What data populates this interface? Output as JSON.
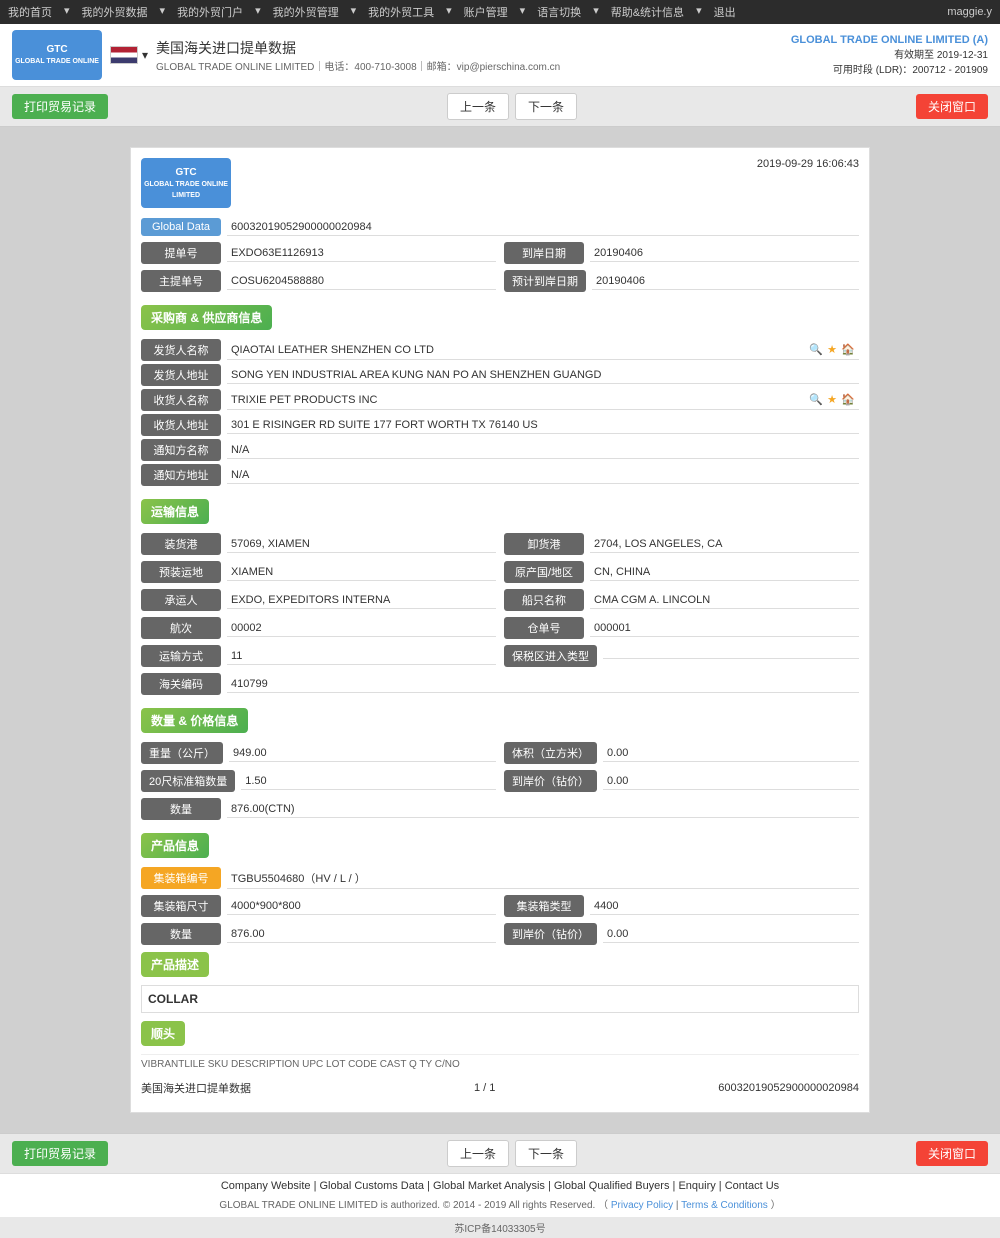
{
  "topnav": {
    "items": [
      "我的首页",
      "我的外贸数据",
      "我的外贸门户",
      "我的外贸管理",
      "我的外贸工具",
      "账户管理",
      "语言切换",
      "帮助&统计信息",
      "退出"
    ],
    "user": "maggie.y"
  },
  "header": {
    "title": "美国海关进口提单数据",
    "subtitle": "GLOBAL TRADE ONLINE LIMITED｜电话：400-710-3008｜邮箱：vip@pierschina.com.cn",
    "company": "GLOBAL TRADE ONLINE LIMITED (A)",
    "expiry_label": "有效期至",
    "expiry_date": "2019-12-31",
    "ldr_label": "可用时段 (LDR)：200712 - 201909"
  },
  "toolbar": {
    "print_label": "打印贸易记录",
    "prev_label": "上一条",
    "next_label": "下一条",
    "close_label": "关闭窗口"
  },
  "document": {
    "datetime": "2019-09-29 16:06:43",
    "global_data_label": "Global Data",
    "global_data_value": "60032019052900000020984",
    "bill_label": "提单号",
    "bill_value": "EXDO63E1126913",
    "arrival_date_label": "到岸日期",
    "arrival_date_value": "20190406",
    "master_bill_label": "主提单号",
    "master_bill_value": "COSU6204588880",
    "estimated_date_label": "预计到岸日期",
    "estimated_date_value": "20190406"
  },
  "shipper": {
    "section_label": "采购商 & 供应商信息",
    "shipper_name_label": "发货人名称",
    "shipper_name_value": "QIAOTAI LEATHER SHENZHEN CO LTD",
    "shipper_addr_label": "发货人地址",
    "shipper_addr_value": "SONG YEN INDUSTRIAL AREA KUNG NAN PO AN SHENZHEN GUANGD",
    "consignee_name_label": "收货人名称",
    "consignee_name_value": "TRIXIE PET PRODUCTS INC",
    "consignee_addr_label": "收货人地址",
    "consignee_addr_value": "301 E RISINGER RD SUITE 177 FORT WORTH TX 76140 US",
    "notify_name_label": "通知方名称",
    "notify_name_value": "N/A",
    "notify_addr_label": "通知方地址",
    "notify_addr_value": "N/A"
  },
  "transport": {
    "section_label": "运输信息",
    "loading_port_label": "装货港",
    "loading_port_value": "57069, XIAMEN",
    "discharge_port_label": "卸货港",
    "discharge_port_value": "2704, LOS ANGELES, CA",
    "pre_load_label": "预装运地",
    "pre_load_value": "XIAMEN",
    "origin_label": "原产国/地区",
    "origin_value": "CN, CHINA",
    "carrier_label": "承运人",
    "carrier_value": "EXDO, EXPEDITORS INTERNA",
    "vessel_label": "船只名称",
    "vessel_value": "CMA CGM A. LINCOLN",
    "voyage_label": "航次",
    "voyage_value": "00002",
    "warehouse_label": "仓单号",
    "warehouse_value": "000001",
    "transport_mode_label": "运输方式",
    "transport_mode_value": "11",
    "bonded_label": "保税区进入类型",
    "bonded_value": "",
    "customs_label": "海关编码",
    "customs_value": "410799"
  },
  "quantity": {
    "section_label": "数量 & 价格信息",
    "weight_label": "重量（公斤）",
    "weight_value": "949.00",
    "volume_label": "体积（立方米）",
    "volume_value": "0.00",
    "twenty_ft_label": "20尺标准箱数量",
    "twenty_ft_value": "1.50",
    "arrival_price_label": "到岸价（钻价）",
    "arrival_price_value": "0.00",
    "quantity_label": "数量",
    "quantity_value": "876.00(CTN)"
  },
  "product": {
    "section_label": "产品信息",
    "container_no_label": "集装箱编号",
    "container_no_value": "TGBU5504680（HV / L / ）",
    "container_size_label": "集装箱尺寸",
    "container_size_value": "4000*900*800",
    "container_type_label": "集装箱类型",
    "container_type_value": "4400",
    "quantity_label": "数量",
    "quantity_value": "876.00",
    "arrival_price_label": "到岸价（钻价）",
    "arrival_price_value": "0.00",
    "desc_section_label": "产品描述",
    "desc_value": "COLLAR",
    "header_btn_label": "顺头",
    "vibrant_row": "VIBRANTLILE SKU DESCRIPTION UPC LOT CODE CAST Q TY C/NO"
  },
  "pagination": {
    "source_label": "美国海关进口提单数据",
    "page": "1 / 1",
    "record_id": "60032019052900000020984"
  },
  "footer": {
    "links": [
      "Company Website",
      "Global Customs Data",
      "Global Market Analysis",
      "Global Qualified Buyers",
      "Enquiry",
      "Contact Us"
    ],
    "copyright": "GLOBAL TRADE ONLINE LIMITED is authorized. © 2014 - 2019 All rights Reserved.  （",
    "privacy": "Privacy Policy",
    "separator": "|",
    "terms": "Terms & Conditions",
    "copyright_end": "）",
    "icp": "苏ICP备14033305号"
  }
}
